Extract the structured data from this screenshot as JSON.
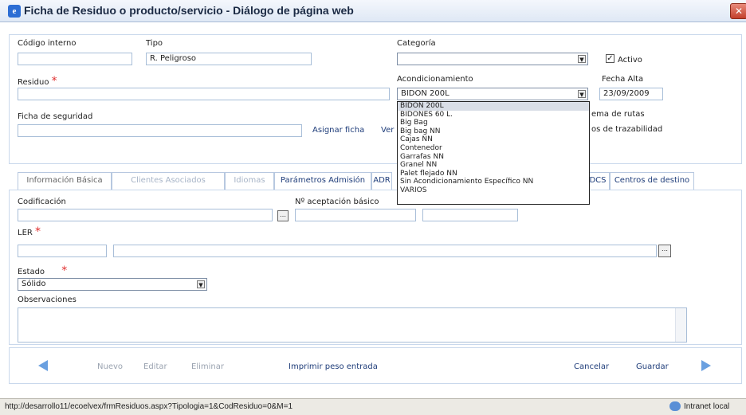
{
  "window": {
    "title": "Ficha de Residuo o producto/servicio - Diálogo de página web"
  },
  "header": {
    "codigo_interno_label": "Código interno",
    "codigo_interno_value": "",
    "tipo_label": "Tipo",
    "tipo_value": "R. Peligroso",
    "categoria_label": "Categoría",
    "categoria_value": "",
    "activo_label": "Activo",
    "activo_checked": true,
    "residuo_label": "Residuo",
    "residuo_value": "",
    "acondicionamiento_label": "Acondicionamiento",
    "acondicionamiento_value": "BIDON 200L",
    "fecha_alta_label": "Fecha Alta",
    "fecha_alta_value": "23/09/2009",
    "ficha_seguridad_label": "Ficha de seguridad",
    "ficha_seguridad_value": "",
    "asignar_ficha_link": "Asignar ficha",
    "ver_link": "Ver",
    "hidden_text_1": "ema de rutas",
    "hidden_text_2": "os de trazabilidad"
  },
  "dropdown": {
    "options": [
      "BIDON 200L",
      "BIDONES 60 L.",
      "Big Bag",
      "Big bag NN",
      "Cajas NN",
      "Contenedor",
      "Garrafas NN",
      "Granel NN",
      "Palet flejado NN",
      "Sin Acondicionamiento Específico NN",
      "VARIOS"
    ],
    "selected_index": 0
  },
  "tabs": [
    {
      "label": "Información Básica",
      "state": "active"
    },
    {
      "label": "Clientes Asociados",
      "state": "disabled"
    },
    {
      "label": "Idiomas",
      "state": "disabled"
    },
    {
      "label": "Parámetros Admisión",
      "state": "normal"
    },
    {
      "label": "ADR",
      "state": "normal"
    },
    {
      "label": "DCS",
      "state": "normal"
    },
    {
      "label": "Centros de destino",
      "state": "normal"
    }
  ],
  "basic_info": {
    "codificacion_label": "Codificación",
    "codificacion_value": "",
    "aceptacion_label": "Nº aceptación básico",
    "aceptacion_value": "",
    "ler_label": "LER",
    "ler_code": "",
    "ler_desc": "",
    "estado_label": "Estado",
    "estado_value": "Sólido",
    "observaciones_label": "Observaciones",
    "observaciones_value": ""
  },
  "footer": {
    "nuevo": "Nuevo",
    "editar": "Editar",
    "eliminar": "Eliminar",
    "imprimir": "Imprimir peso entrada",
    "cancelar": "Cancelar",
    "guardar": "Guardar"
  },
  "statusbar": {
    "url": "http://desarrollo11/ecoelvex/frmResiduos.aspx?Tipologia=1&CodResiduo=0&M=1",
    "zone": "Intranet local"
  },
  "colors": {
    "accent": "#1f3d7a",
    "required": "#e03030",
    "nav_arrow": "#6aa0e0"
  }
}
